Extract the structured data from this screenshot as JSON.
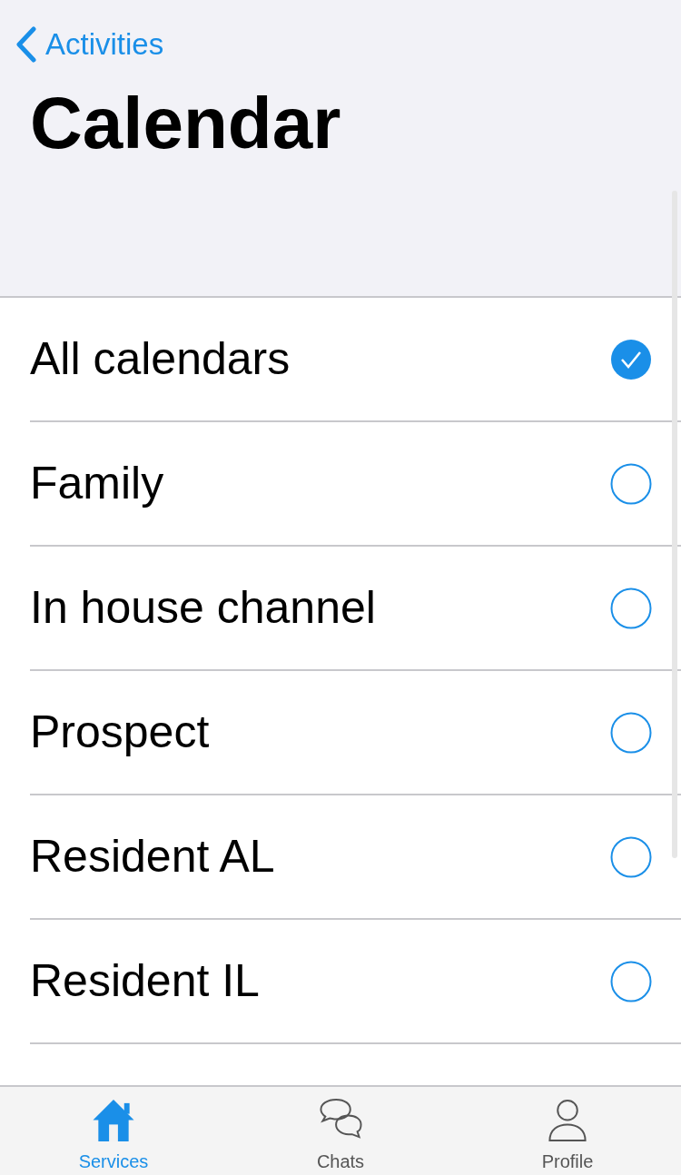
{
  "nav": {
    "back_label": "Activities",
    "title": "Calendar"
  },
  "calendars": [
    {
      "name": "All calendars",
      "selected": true
    },
    {
      "name": "Family",
      "selected": false
    },
    {
      "name": "In house channel",
      "selected": false
    },
    {
      "name": "Prospect",
      "selected": false
    },
    {
      "name": "Resident AL",
      "selected": false
    },
    {
      "name": "Resident IL",
      "selected": false
    }
  ],
  "tab_bar": [
    {
      "label": "Services",
      "kind": "home",
      "selected": true
    },
    {
      "label": "Chats",
      "kind": "chats",
      "selected": false
    },
    {
      "label": "Profile",
      "kind": "profile",
      "selected": false
    }
  ]
}
